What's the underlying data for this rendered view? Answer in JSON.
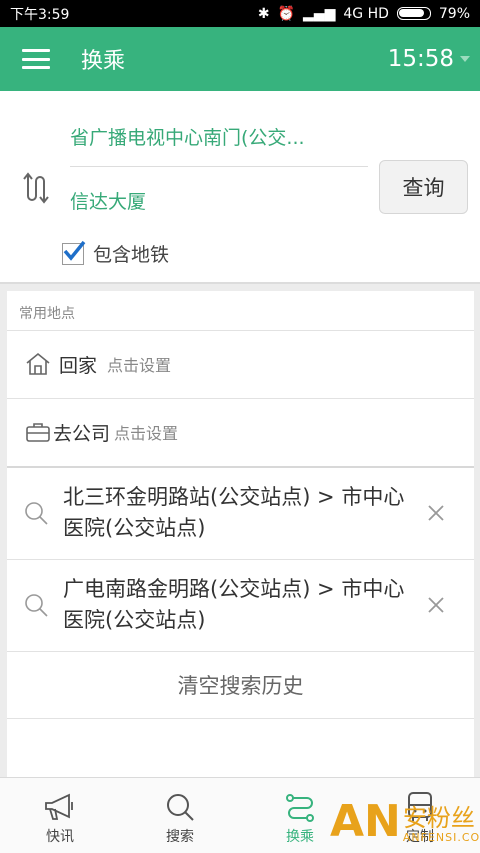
{
  "status_bar": {
    "time": "下午3:59",
    "network": "4G HD",
    "battery": "79%"
  },
  "app_bar": {
    "title": "换乘",
    "time": "15:58"
  },
  "route": {
    "from": "省广播电视中心南门(公交...",
    "to": "信达大厦",
    "query_label": "查询",
    "include_subway_label": "包含地铁",
    "include_subway_checked": true
  },
  "favorites": {
    "section_label": "常用地点",
    "items": [
      {
        "name": "回家",
        "hint": "点击设置",
        "icon": "home-icon"
      },
      {
        "name": "去公司",
        "hint": "点击设置",
        "icon": "briefcase-icon"
      }
    ]
  },
  "history": {
    "items": [
      {
        "text": "北三环金明路站(公交站点) > 市中心医院(公交站点)"
      },
      {
        "text": "广电南路金明路(公交站点) > 市中心医院(公交站点)"
      }
    ],
    "clear_label": "清空搜索历史"
  },
  "bottom_nav": {
    "tabs": [
      {
        "label": "快讯",
        "icon": "megaphone-icon"
      },
      {
        "label": "搜索",
        "icon": "search-icon"
      },
      {
        "label": "换乘",
        "icon": "transfer-icon"
      },
      {
        "label": "定制",
        "icon": "bus-icon"
      }
    ],
    "active_index": 2
  },
  "watermark": {
    "logo_text": "AN",
    "cn_text": "安粉丝",
    "en_text": "ANFENSI.COM"
  },
  "colors": {
    "accent": "#37b37e",
    "accent_text": "#37a978",
    "watermark": "#e8a21b"
  }
}
